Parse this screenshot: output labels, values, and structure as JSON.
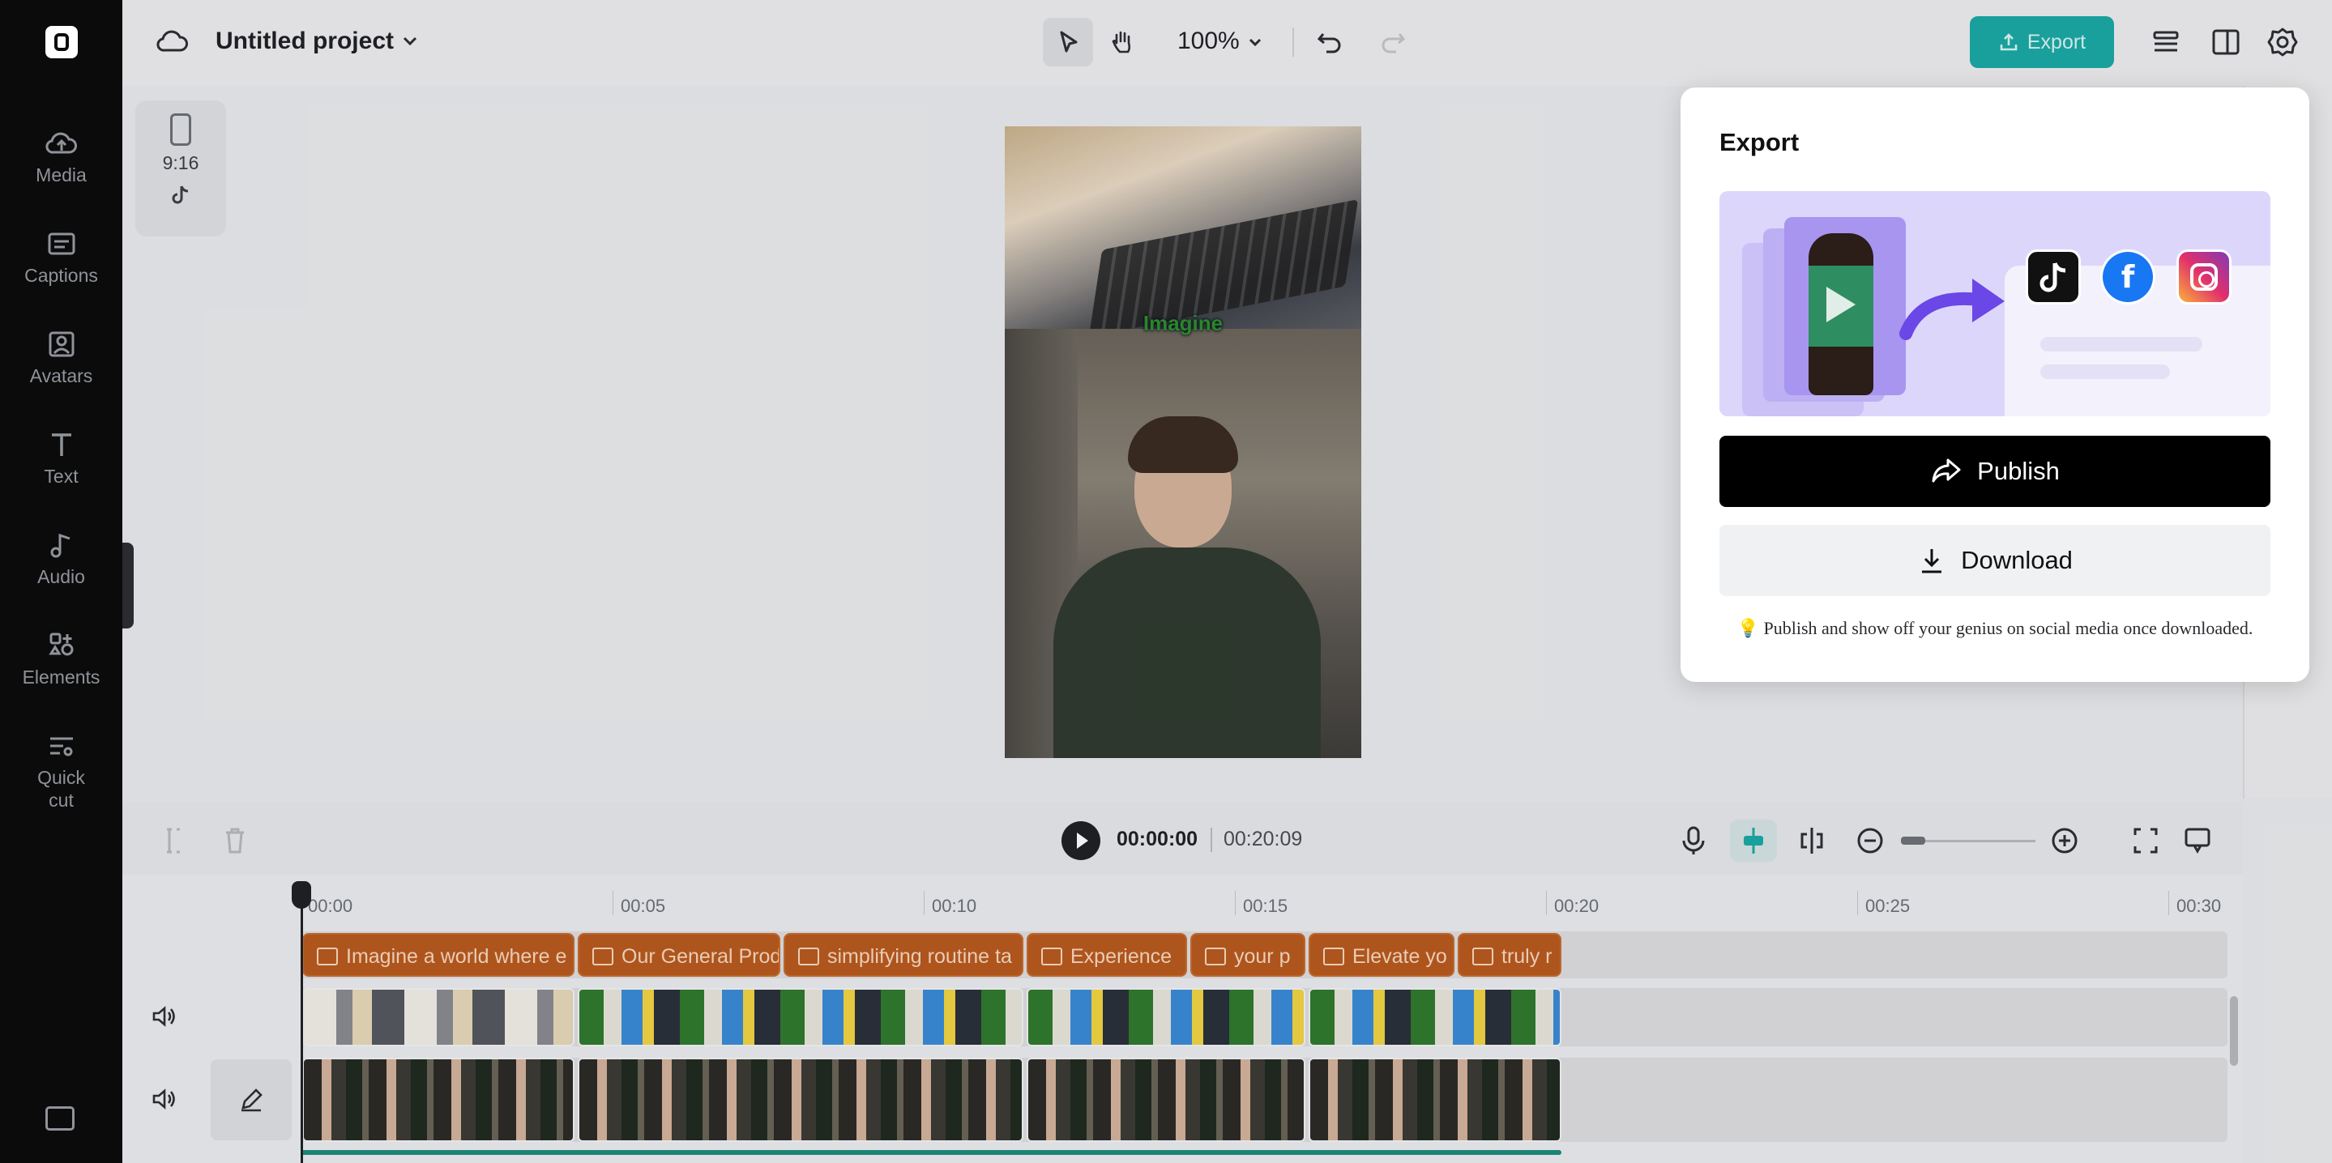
{
  "app": {
    "project_title": "Untitled project",
    "zoom_level": "100%",
    "export_label": "Export"
  },
  "sidebar": {
    "items": [
      {
        "label": "Media",
        "icon": "cloud-upload-icon"
      },
      {
        "label": "Captions",
        "icon": "captions-icon"
      },
      {
        "label": "Avatars",
        "icon": "avatar-icon"
      },
      {
        "label": "Text",
        "icon": "text-icon"
      },
      {
        "label": "Audio",
        "icon": "music-note-icon"
      },
      {
        "label": "Elements",
        "icon": "elements-icon"
      },
      {
        "label": "Quick",
        "label2": "cut",
        "icon": "quick-cut-icon"
      }
    ]
  },
  "canvas": {
    "aspect_ratio": "9:16",
    "caption_overlay": "Imagine"
  },
  "playback": {
    "current_time": "00:00:00",
    "total_time": "00:20:09"
  },
  "ruler": {
    "labels": [
      "00:00",
      "00:05",
      "00:10",
      "00:15",
      "00:20",
      "00:25",
      "00:30"
    ]
  },
  "caption_track": {
    "segments": [
      "Imagine a world where e",
      "Our General Prod",
      "simplifying routine ta",
      "Experience",
      "your p",
      "Elevate yo",
      "truly r"
    ]
  },
  "export_panel": {
    "title": "Export",
    "publish_label": "Publish",
    "download_label": "Download",
    "tip": "💡 Publish and show off your genius on social media once downloaded.",
    "platforms": [
      "tiktok-logo-icon",
      "facebook-logo-icon",
      "instagram-logo-icon"
    ],
    "facebook_glyph": "f"
  },
  "colors": {
    "accent_teal": "#1aa9a4",
    "caption_orange": "#b85a1d",
    "sidebar_bg": "#0b0b0c",
    "publish_bg": "#000000"
  }
}
